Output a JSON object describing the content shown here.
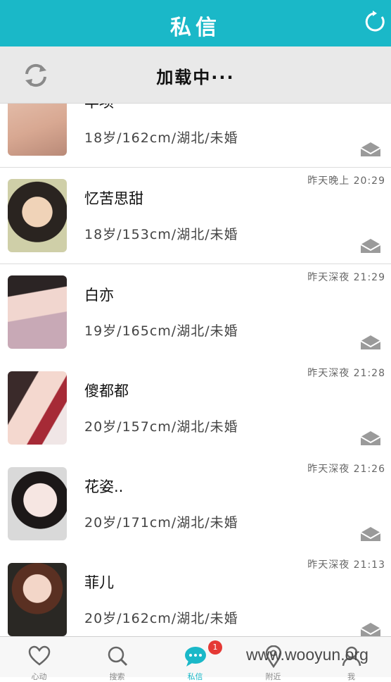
{
  "header": {
    "title": "私信"
  },
  "loading": {
    "text": "加载中···"
  },
  "rows": [
    {
      "name": "丰项",
      "info": "18岁/162cm/湖北/未婚",
      "time": ""
    },
    {
      "name": "忆苦思甜",
      "info": "18岁/153cm/湖北/未婚",
      "time": "昨天晚上 20:29"
    },
    {
      "name": "白亦",
      "info": "19岁/165cm/湖北/未婚",
      "time": "昨天深夜 21:29"
    },
    {
      "name": "傻都都",
      "info": "20岁/157cm/湖北/未婚",
      "time": "昨天深夜 21:28"
    },
    {
      "name": "花姿..",
      "info": "20岁/171cm/湖北/未婚",
      "time": "昨天深夜 21:26"
    },
    {
      "name": "菲儿",
      "info": "20岁/162cm/湖北/未婚",
      "time": "昨天深夜 21:13"
    }
  ],
  "tabs": [
    {
      "label": "心动",
      "icon": "heart-icon"
    },
    {
      "label": "搜索",
      "icon": "search-icon"
    },
    {
      "label": "私信",
      "icon": "chat-icon"
    },
    {
      "label": "附近",
      "icon": "location-icon"
    },
    {
      "label": "我",
      "icon": "user-icon"
    }
  ],
  "badge": {
    "count": "1"
  },
  "watermark": "www.wooyun.org",
  "colors": {
    "accent": "#1ab8c8",
    "badge": "#e53935"
  }
}
